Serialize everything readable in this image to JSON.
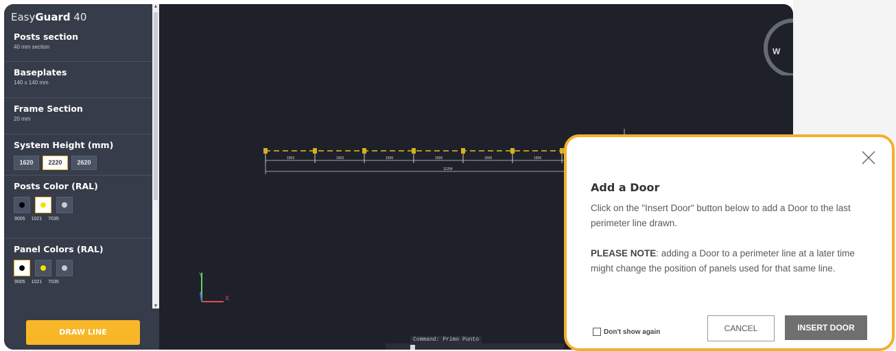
{
  "sidebar": {
    "brand_regular": "Easy",
    "brand_bold": "Guard",
    "brand_suffix": " 40",
    "sections": [
      {
        "title": "Posts section",
        "subtitle": "40 mm section"
      },
      {
        "title": "Baseplates",
        "subtitle": "140 x 140 mm"
      },
      {
        "title": "Frame Section",
        "subtitle": "20 mm"
      }
    ],
    "system_height": {
      "title": "System Height (mm)",
      "options": [
        "1620",
        "2220",
        "2620"
      ],
      "selected": "2220"
    },
    "posts_color": {
      "title": "Posts Color (RAL)",
      "options": [
        "9005",
        "1021",
        "7035"
      ],
      "selected": "1021"
    },
    "panel_colors": {
      "title": "Panel Colors (RAL)",
      "options": [
        "9005",
        "1021",
        "7035"
      ],
      "selected": "9005"
    },
    "draw_button": "DRAW LINE"
  },
  "canvas": {
    "segment_labels": [
      "1503",
      "1503",
      "1506",
      "1506",
      "1506",
      "1506"
    ],
    "total_label": "11254",
    "compass_letter": "W",
    "command_text": "Command:  Primo Punto"
  },
  "dialog": {
    "title": "Add a Door",
    "body_line1": "Click on the \"Insert Door\" button below to add a Door to the last perimeter line drawn.",
    "note_bold": "PLEASE NOTE",
    "note_rest": ": adding a Door to a perimeter line at a later time might change the position of panels used for that same line.",
    "dont_show": "Don't show again",
    "cancel": "CANCEL",
    "insert": "INSERT DOOR"
  },
  "colors": {
    "accent": "#f7b728",
    "ral_9005": "#000000",
    "ral_1021": "#f5e000",
    "ral_7035": "#c8cbd0",
    "sidebar_bg": "#363c49",
    "canvas_bg": "#1e2129"
  }
}
